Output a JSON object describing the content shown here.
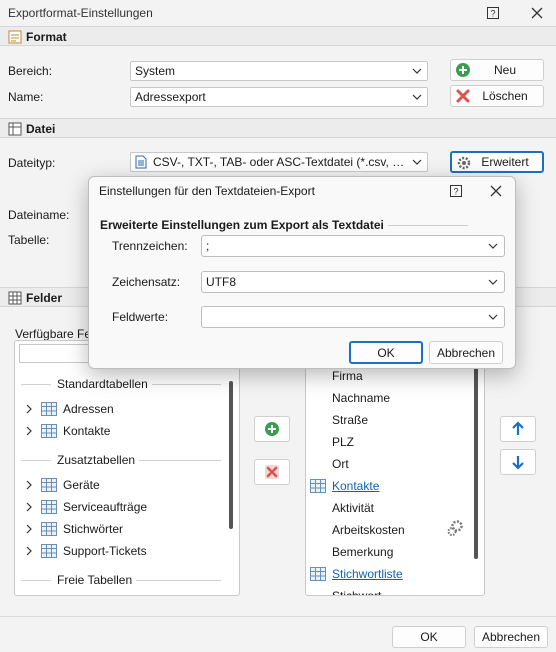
{
  "window": {
    "title": "Exportformat-Einstellungen"
  },
  "format": {
    "header": "Format",
    "bereich_label": "Bereich:",
    "bereich_value": "System",
    "name_label": "Name:",
    "name_value": "Adressexport",
    "neu_label": "Neu",
    "loeschen_label": "Löschen"
  },
  "datei": {
    "header": "Datei",
    "dateityp_label": "Dateityp:",
    "dateityp_value": "CSV-, TXT-, TAB- oder ASC-Textdatei (*.csv, *.tx...",
    "erweitert_label": "Erweitert",
    "dateiname_label": "Dateiname:",
    "tabelle_label": "Tabelle:"
  },
  "felder": {
    "header": "Felder",
    "available_label": "Verfügbare Felder",
    "groups": [
      {
        "title": "Standardtabellen",
        "items": [
          "Adressen",
          "Kontakte"
        ]
      },
      {
        "title": "Zusatztabellen",
        "items": [
          "Geräte",
          "Serviceaufträge",
          "Stichwörter",
          "Support-Tickets"
        ]
      },
      {
        "title": "Freie Tabellen",
        "items": []
      }
    ],
    "selected": [
      {
        "text": "Firma",
        "type": "field"
      },
      {
        "text": "Nachname",
        "type": "field"
      },
      {
        "text": "Straße",
        "type": "field"
      },
      {
        "text": "PLZ",
        "type": "field"
      },
      {
        "text": "Ort",
        "type": "field"
      },
      {
        "text": "Kontakte",
        "type": "table"
      },
      {
        "text": "Aktivität",
        "type": "field"
      },
      {
        "text": "Arbeitskosten",
        "type": "field"
      },
      {
        "text": "Bemerkung",
        "type": "field"
      },
      {
        "text": "Stichwortliste",
        "type": "table"
      },
      {
        "text": "Stichwort",
        "type": "field"
      }
    ]
  },
  "footer": {
    "ok": "OK",
    "abbrechen": "Abbrechen"
  },
  "dialog": {
    "title": "Einstellungen für den Textdateien-Export",
    "group": "Erweiterte Einstellungen zum Export als Textdatei",
    "trennzeichen_label": "Trennzeichen:",
    "trennzeichen_value": ";",
    "zeichensatz_label": "Zeichensatz:",
    "zeichensatz_value": "UTF8",
    "feldwerte_label": "Feldwerte:",
    "feldwerte_value": "",
    "ok": "OK",
    "abbrechen": "Abbrechen"
  },
  "colors": {
    "accent": "#1e6fc2",
    "add_green": "#3a9d50",
    "delete_red": "#d9534f",
    "link": "#0b63b6"
  }
}
